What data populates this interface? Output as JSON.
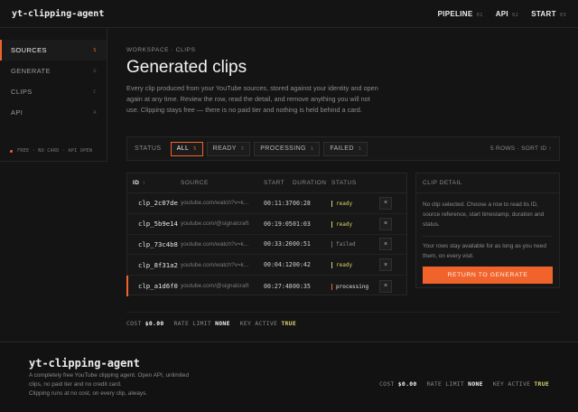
{
  "brand": "yt-clipping-agent",
  "topnav": [
    {
      "label": "PIPELINE",
      "num": "01"
    },
    {
      "label": "API",
      "num": "02"
    },
    {
      "label": "START",
      "num": "03"
    }
  ],
  "sidebar": {
    "items": [
      {
        "label": "SOURCES",
        "key": "S",
        "active": true
      },
      {
        "label": "GENERATE",
        "key": "G"
      },
      {
        "label": "CLIPS",
        "key": "C"
      },
      {
        "label": "API",
        "key": "A"
      }
    ],
    "footer": "FREE · NO CARD · API OPEN"
  },
  "main": {
    "breadcrumb": "WORKSPACE · CLIPS",
    "title": "Generated clips",
    "intro": "Every clip produced from your YouTube sources, stored against your identity and open again at any time. Review the row, read the detail, and remove anything you will not use. Clipping stays free — there is no paid tier and nothing is held behind a card."
  },
  "filters": {
    "label": "STATUS",
    "chips": [
      {
        "label": "ALL",
        "count": "5",
        "active": true
      },
      {
        "label": "READY",
        "count": "3"
      },
      {
        "label": "PROCESSING",
        "count": "1"
      },
      {
        "label": "FAILED",
        "count": "1"
      }
    ],
    "rows_info": "5 ROWS · SORT ID ↑"
  },
  "table": {
    "headers": {
      "id": "ID",
      "id_arrow": "↑",
      "source": "SOURCE",
      "start": "START",
      "duration": "DURATION",
      "status": "STATUS"
    },
    "rows": [
      {
        "id": "clp_2c07de",
        "source": "youtube.com/watch?v=k...",
        "start": "00:11:37",
        "duration": "00:28",
        "status": "ready"
      },
      {
        "id": "clp_5b9e14",
        "source": "youtube.com/@signalcraft",
        "start": "00:19:05",
        "duration": "01:03",
        "status": "ready"
      },
      {
        "id": "clp_73c4b8",
        "source": "youtube.com/watch?v=k...",
        "start": "00:33:20",
        "duration": "00:51",
        "status": "failed"
      },
      {
        "id": "clp_8f31a2",
        "source": "youtube.com/watch?v=k...",
        "start": "00:04:12",
        "duration": "00:42",
        "status": "ready"
      },
      {
        "id": "clp_a1d6f0",
        "source": "youtube.com/@signalcraft",
        "start": "00:27:48",
        "duration": "00:35",
        "status": "processing",
        "selected": true
      }
    ],
    "remove_glyph": "×"
  },
  "detail": {
    "title": "CLIP DETAIL",
    "empty_text": "No clip selected. Choose a row to read its ID, source reference, start timestamp, duration and status.",
    "note": "Your rows stay available for as long as you need them, on every visit.",
    "cta": "RETURN TO GENERATE"
  },
  "status_strip": {
    "cost_label": "COST",
    "cost_value": "$0.00",
    "rate_label": "RATE LIMIT",
    "rate_value": "NONE",
    "key_label": "KEY ACTIVE",
    "key_value": "TRUE"
  },
  "footer": {
    "brand": "yt-clipping-agent",
    "line1": "A completely free YouTube clipping agent. Open API, unlimited clips, no paid tier and no credit card.",
    "line2": "Clipping runs at no cost, on every clip, always."
  },
  "colors": {
    "accent": "#f0642c",
    "ready": "#d8d36a",
    "background": "#141414"
  }
}
